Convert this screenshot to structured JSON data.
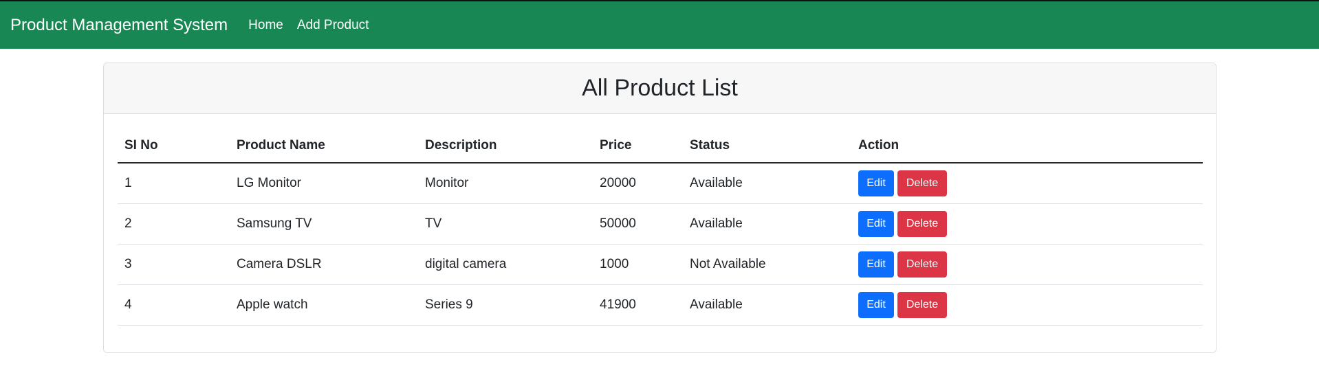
{
  "navbar": {
    "brand": "Product Management System",
    "links": [
      "Home",
      "Add Product"
    ]
  },
  "card": {
    "title": "All Product List"
  },
  "table": {
    "headers": [
      "SI No",
      "Product Name",
      "Description",
      "Price",
      "Status",
      "Action"
    ],
    "rows": [
      {
        "sl": "1",
        "name": "LG Monitor",
        "description": "Monitor",
        "price": "20000",
        "status": "Available"
      },
      {
        "sl": "2",
        "name": "Samsung TV",
        "description": "TV",
        "price": "50000",
        "status": "Available"
      },
      {
        "sl": "3",
        "name": "Camera DSLR",
        "description": "digital camera",
        "price": "1000",
        "status": "Not Available"
      },
      {
        "sl": "4",
        "name": "Apple watch",
        "description": "Series 9",
        "price": "41900",
        "status": "Available"
      }
    ],
    "edit_label": "Edit",
    "delete_label": "Delete"
  },
  "colors": {
    "navbar": "#198754",
    "edit": "#0d6efd",
    "delete": "#dc3545"
  }
}
